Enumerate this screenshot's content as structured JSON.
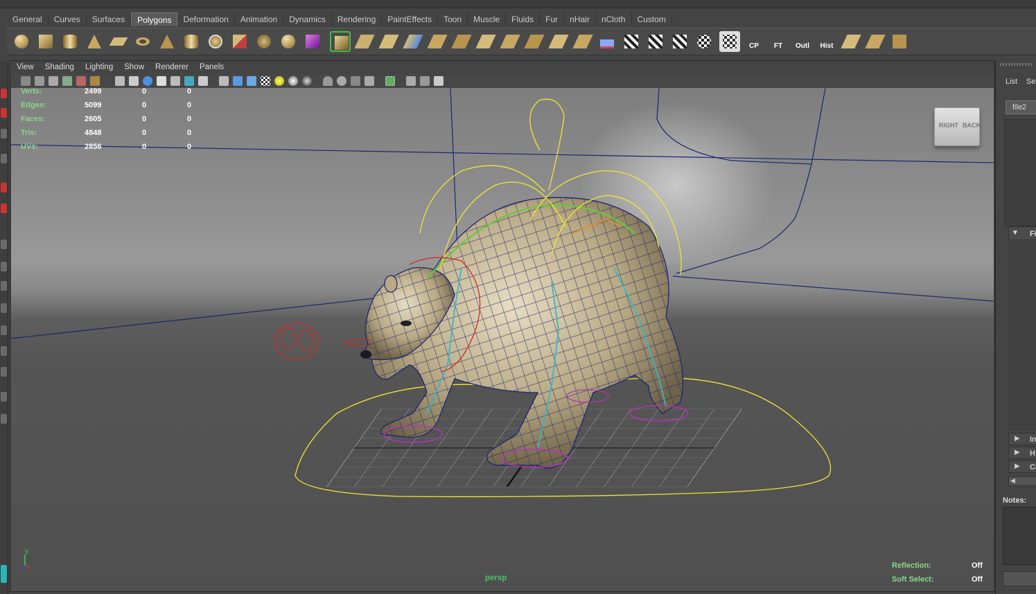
{
  "shelf_tabs": [
    "General",
    "Curves",
    "Surfaces",
    "Polygons",
    "Deformation",
    "Animation",
    "Dynamics",
    "Rendering",
    "PaintEffects",
    "Toon",
    "Muscle",
    "Fluids",
    "Fur",
    "nHair",
    "nCloth",
    "Custom"
  ],
  "active_shelf_tab": "Polygons",
  "shelf_text_tools": {
    "cp": "CP",
    "ft": "FT",
    "outl": "Outl",
    "hist": "Hist"
  },
  "panel_menu": [
    "View",
    "Shading",
    "Lighting",
    "Show",
    "Renderer",
    "Panels"
  ],
  "hud": {
    "rows": [
      {
        "label": "Verts:",
        "values": [
          "2499",
          "0",
          "0"
        ]
      },
      {
        "label": "Edges:",
        "values": [
          "5099",
          "0",
          "0"
        ]
      },
      {
        "label": "Faces:",
        "values": [
          "2605",
          "0",
          "0"
        ]
      },
      {
        "label": "Tris:",
        "values": [
          "4848",
          "0",
          "0"
        ]
      },
      {
        "label": "UVs:",
        "values": [
          "2856",
          "0",
          "0"
        ]
      }
    ],
    "camera_name": "persp",
    "reflection_label": "Reflection:",
    "reflection_value": "Off",
    "soft_select_label": "Soft Select:",
    "soft_select_value": "Off",
    "axis_y": "y"
  },
  "viewcube": {
    "right": "RIGHT",
    "back": "BACK"
  },
  "right_panel": {
    "list_label": "List",
    "sel_label": "Sel",
    "file_tab": "file2",
    "section_f": "Fi",
    "row_i": "In",
    "row_h": "H",
    "row_c": "Ca",
    "notes_label": "Notes:"
  },
  "colors": {
    "hud_label": "#89d78b",
    "camera_label": "#4fbf62",
    "wire": "#1c2670",
    "control_curve": "#f1e632",
    "bear_fur": "#b9a984"
  }
}
